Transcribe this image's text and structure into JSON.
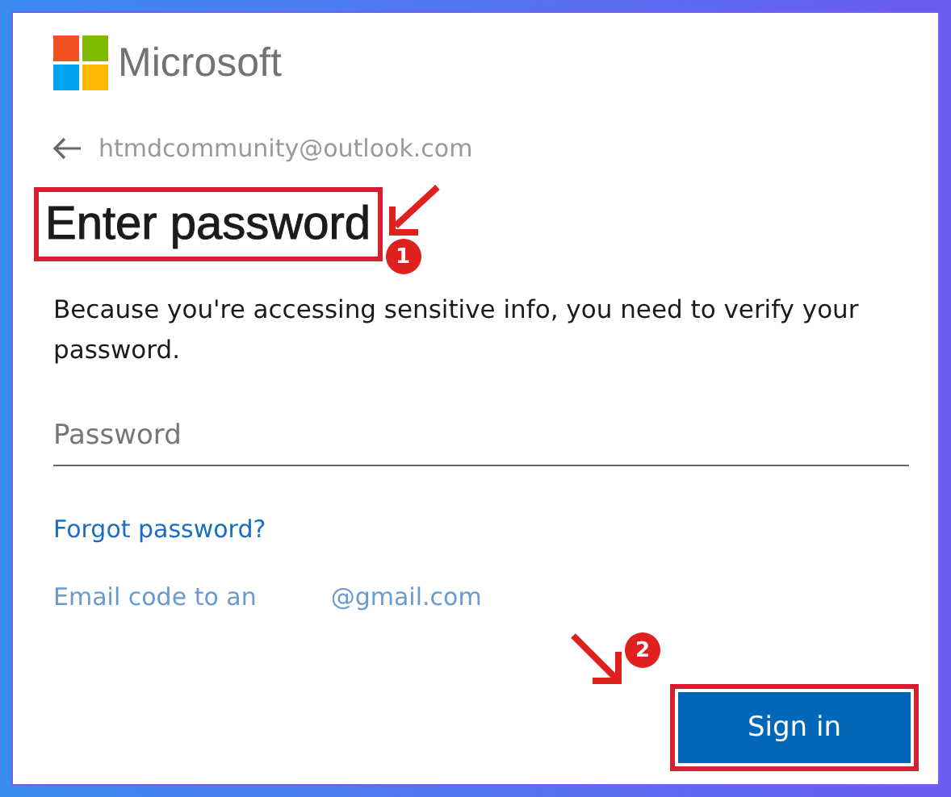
{
  "brand": {
    "name": "Microsoft"
  },
  "account": {
    "email": "htmdcommunity@outlook.com"
  },
  "heading": {
    "text": "Enter password",
    "step": "1"
  },
  "description": "Because you're accessing sensitive info, you need to verify your password.",
  "password_field": {
    "placeholder": "Password"
  },
  "links": [
    {
      "kind": "plain",
      "text": "Forgot password?"
    },
    {
      "kind": "split",
      "text": "Email code to an",
      "suffix": "@gmail.com"
    }
  ],
  "button": {
    "text": "Sign in",
    "step": "2"
  }
}
